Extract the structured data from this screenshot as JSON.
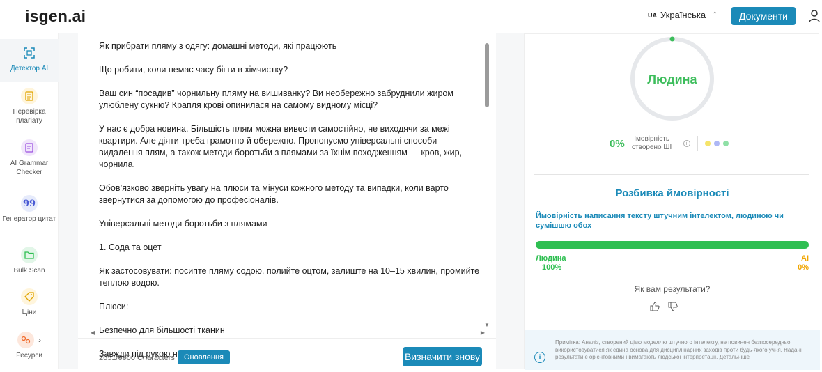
{
  "header": {
    "logo": "isgen.ai",
    "lang_code": "UA",
    "lang_label": "Українська",
    "lang_chevron": "⌃",
    "docs_button": "Документи"
  },
  "sidebar": {
    "items": [
      {
        "label": "Детектор AI",
        "icon": "scan-icon"
      },
      {
        "label": "Перевірка плагіату",
        "icon": "document-icon"
      },
      {
        "label": "AI Grammar Checker",
        "icon": "grammar-icon"
      },
      {
        "label": "Генератор цитат",
        "icon": "quote-icon"
      },
      {
        "label": "Bulk Scan",
        "icon": "folder-icon"
      },
      {
        "label": "Ціни",
        "icon": "tag-icon"
      },
      {
        "label": "Ресурси",
        "icon": "resources-icon",
        "chevron": "›"
      }
    ]
  },
  "editor": {
    "paragraphs": [
      "Як прибрати пляму з одягу: домашні методи, які працюють",
      "Що робити, коли немає часу бігти в хімчистку?",
      "Ваш син “посадив” чорнильну пляму на вишиванку? Ви необережно забруднили жиром улюблену сукню? Крапля крові опинилася на самому видному місці?",
      "У нас є добра новина. Більшість плям можна вивести самостійно, не виходячи за межі квартири. Але діяти треба грамотно й обережно. Пропонуємо універсальні способи видалення плям, а також методи боротьби з плямами за їхнім походженням — кров, жир, чорнила.",
      "Обов’язково зверніть увагу на плюси та мінуси кожного методу та випадки, коли варто звернутися за допомогою до професіоналів.",
      "Універсальні методи боротьби з плямами",
      "1. Сода та оцет",
      "Як застосовувати: посипте пляму содою, полийте оцтом, залиште на 10–15 хвилин, промийте теплою водою.",
      "Плюси:",
      "Безпечно для більшості тканин",
      "Завжди під рукою на кухні"
    ],
    "char_count": "2651/6000 Characters",
    "update_button": "Оновлення",
    "redo_button": "Визначити знову"
  },
  "results": {
    "verdict": "Людина",
    "ai_probability": "0%",
    "ai_probability_label": "Імовірність створено ШІ",
    "info_glyph": "i",
    "breakdown_title": "Розбивка ймовірності",
    "breakdown_desc": "Ймовірність написання тексту штучним інтелектом, людиною чи сумішшю обох",
    "human_share": 1.0,
    "human_label": "Людина",
    "human_value": "100%",
    "ai_label": "AI",
    "ai_value": "0%",
    "feedback_question": "Як вам результати?",
    "note": "Примітка: Аналіз, створений цією моделлю штучного інтелекту, не повинен безпосередньо використовуватися як єдина основа для дисциплінарних заходів проти будь-якого учня. Надані результати є орієнтовними і вимагають людської інтерпретації. Детальніше",
    "note_glyph": "i"
  },
  "colors": {
    "accent": "#1b8ab8",
    "human": "#3cbd5b",
    "ai": "#f0a500",
    "dot_yellow": "#f5e46a",
    "dot_blue": "#aeb8f5",
    "dot_green": "#8fe0a6"
  }
}
